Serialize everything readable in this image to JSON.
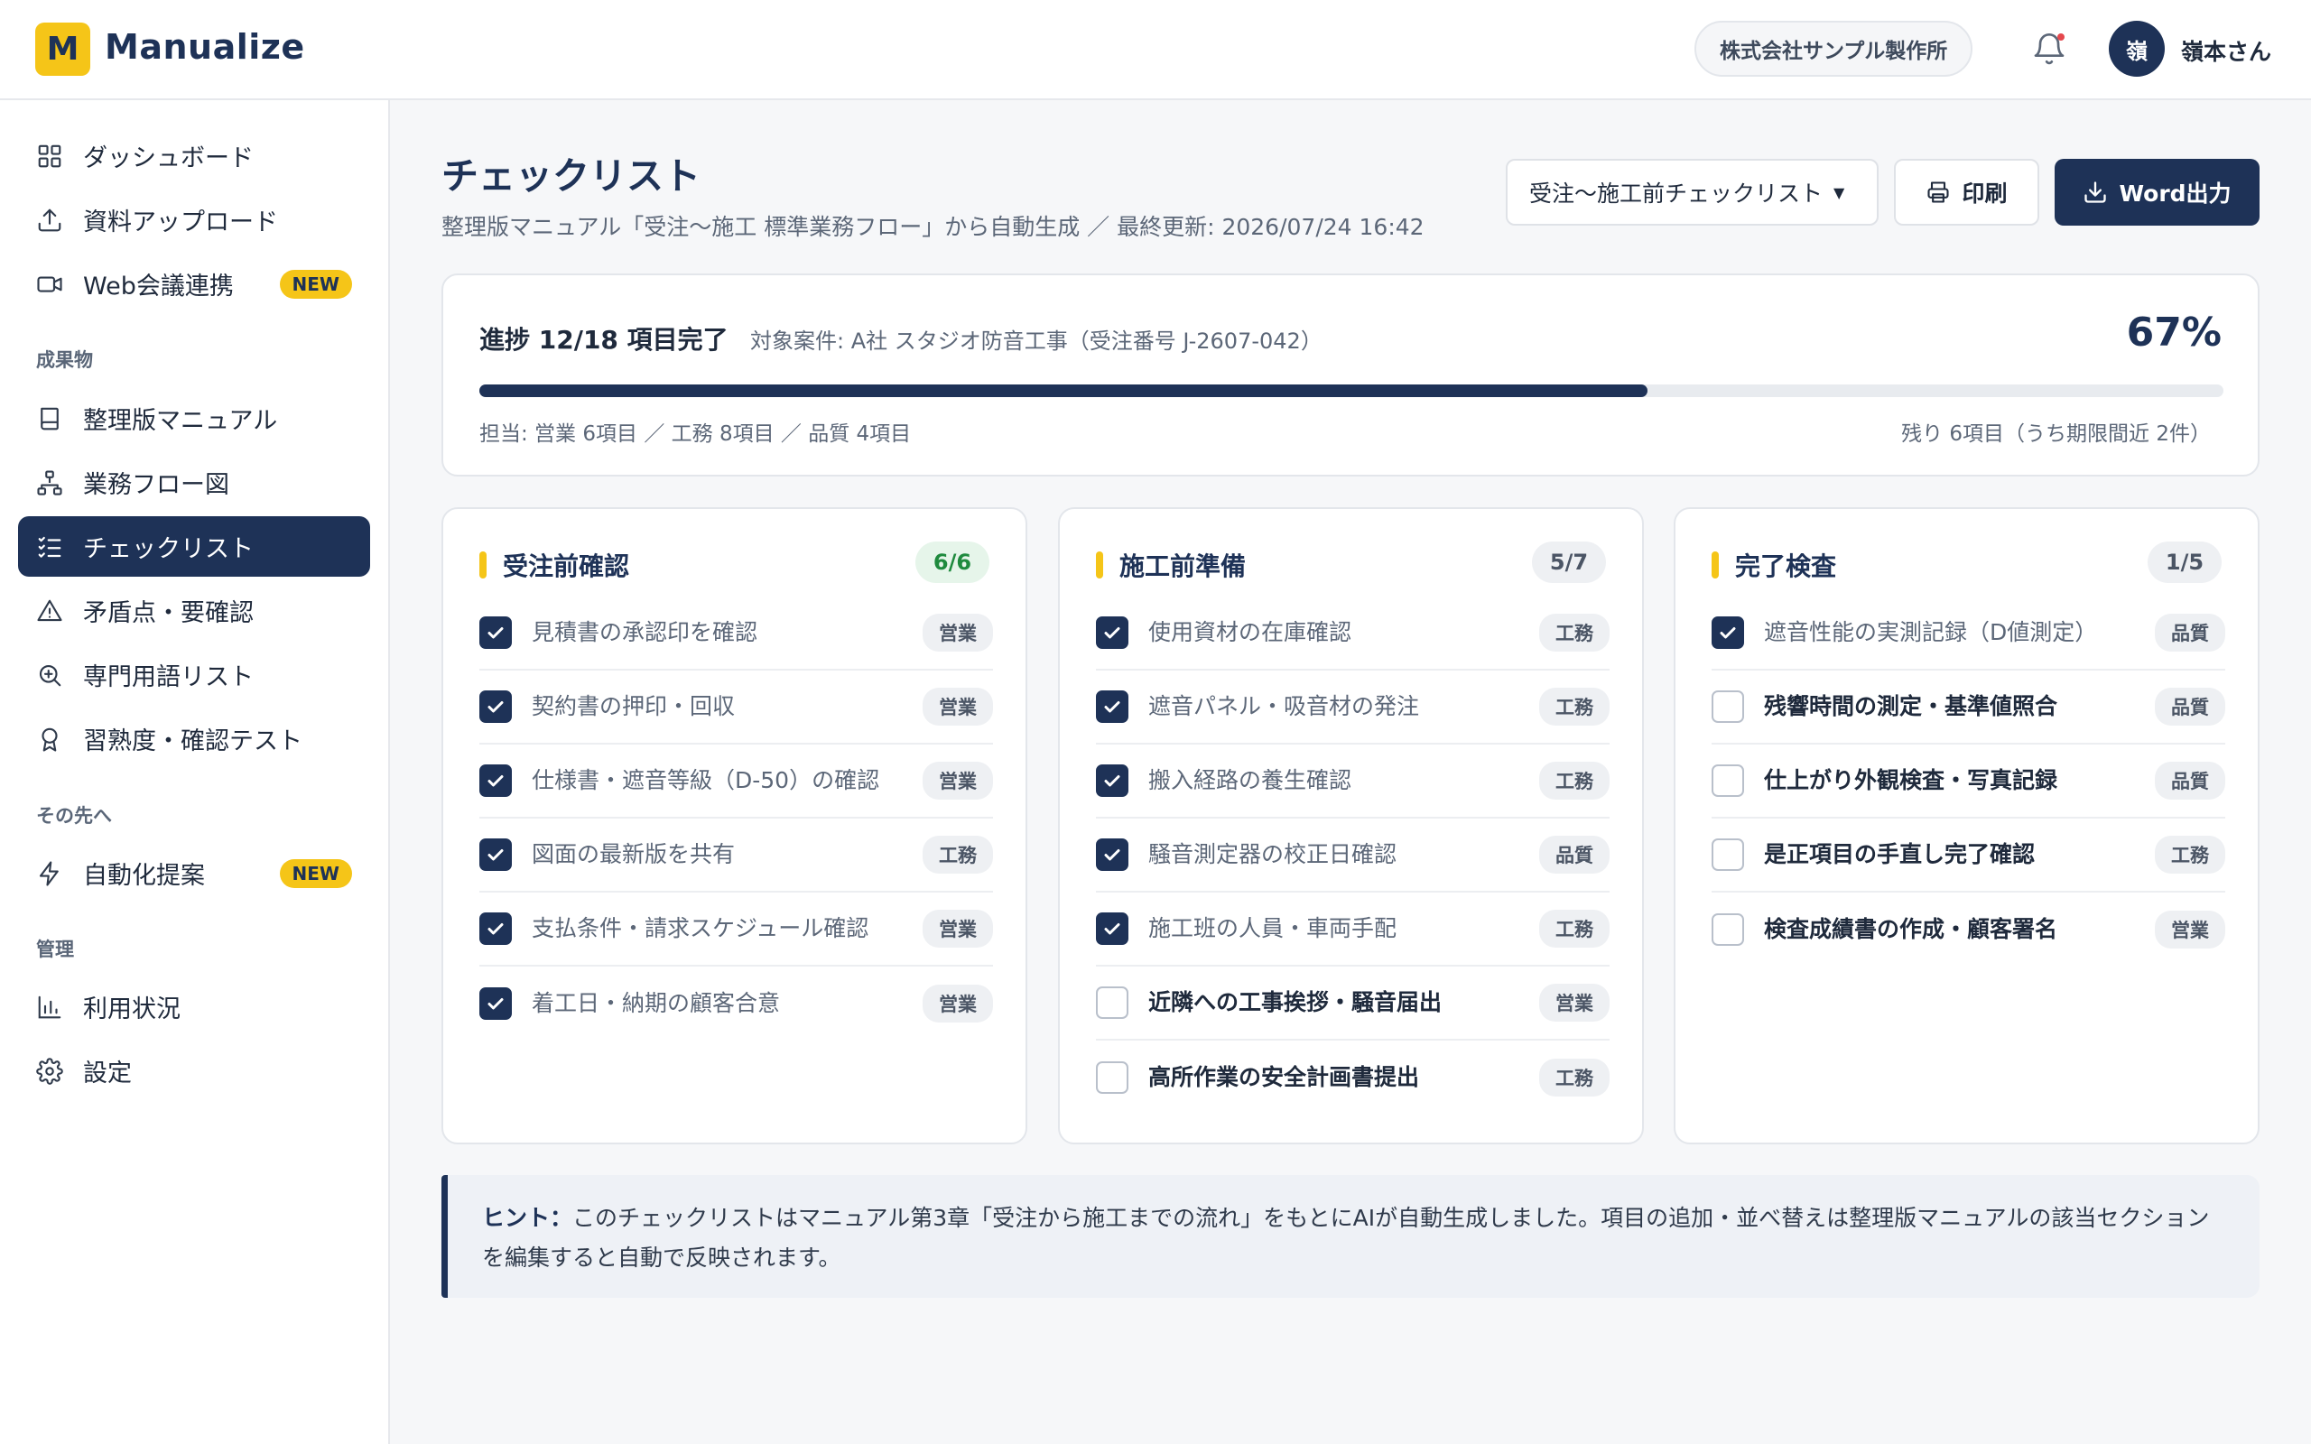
{
  "app": {
    "logo_letter": "M",
    "name": "Manualize"
  },
  "header": {
    "company": "株式会社サンプル製作所",
    "avatar_initial": "嶺",
    "user_name": "嶺本さん"
  },
  "sidebar": {
    "items": [
      {
        "label": "ダッシュボード",
        "icon": "grid-icon"
      },
      {
        "label": "資料アップロード",
        "icon": "upload-icon"
      },
      {
        "label": "Web会議連携",
        "icon": "video-icon",
        "badge": "NEW"
      }
    ],
    "section_outputs": "成果物",
    "output_items": [
      {
        "label": "整理版マニュアル",
        "icon": "book-icon"
      },
      {
        "label": "業務フロー図",
        "icon": "flow-icon"
      },
      {
        "label": "チェックリスト",
        "icon": "checklist-icon",
        "active": true
      },
      {
        "label": "矛盾点・要確認",
        "icon": "warning-icon"
      },
      {
        "label": "専門用語リスト",
        "icon": "magnifier-icon"
      },
      {
        "label": "習熟度・確認テスト",
        "icon": "award-icon"
      }
    ],
    "section_next": "その先へ",
    "next_items": [
      {
        "label": "自動化提案",
        "icon": "lightning-icon",
        "badge": "NEW"
      }
    ],
    "section_admin": "管理",
    "admin_items": [
      {
        "label": "利用状況",
        "icon": "bar-chart-icon"
      },
      {
        "label": "設定",
        "icon": "gear-icon"
      }
    ]
  },
  "main": {
    "title": "チェックリスト",
    "subtitle": "整理版マニュアル「受注〜施工 標準業務フロー」から自動生成 ／ 最終更新: 2026/07/24 16:42",
    "select_value": "受注〜施工前チェックリスト",
    "print_label": "印刷",
    "word_label": "Word出力"
  },
  "progress": {
    "title": "進捗 12/18 項目完了",
    "target": "対象案件: A社 スタジオ防音工事（受注番号 J-2607-042）",
    "percent_label": "67%",
    "fraction": 0.67,
    "assign": "担当: 営業 6項目 ／ 工務 8項目 ／ 品質 4項目",
    "remain": "残り 6項目（うち期限間近 2件）"
  },
  "columns": [
    {
      "title": "受注前確認",
      "count": "6/6",
      "complete": true,
      "items": [
        {
          "label": "見積書の承認印を確認",
          "tag": "営業",
          "checked": true
        },
        {
          "label": "契約書の押印・回収",
          "tag": "営業",
          "checked": true
        },
        {
          "label": "仕様書・遮音等級（D-50）の確認",
          "tag": "営業",
          "checked": true
        },
        {
          "label": "図面の最新版を共有",
          "tag": "工務",
          "checked": true
        },
        {
          "label": "支払条件・請求スケジュール確認",
          "tag": "営業",
          "checked": true
        },
        {
          "label": "着工日・納期の顧客合意",
          "tag": "営業",
          "checked": true
        }
      ]
    },
    {
      "title": "施工前準備",
      "count": "5/7",
      "complete": false,
      "items": [
        {
          "label": "使用資材の在庫確認",
          "tag": "工務",
          "checked": true
        },
        {
          "label": "遮音パネル・吸音材の発注",
          "tag": "工務",
          "checked": true
        },
        {
          "label": "搬入経路の養生確認",
          "tag": "工務",
          "checked": true
        },
        {
          "label": "騒音測定器の校正日確認",
          "tag": "品質",
          "checked": true
        },
        {
          "label": "施工班の人員・車両手配",
          "tag": "工務",
          "checked": true
        },
        {
          "label": "近隣への工事挨拶・騒音届出",
          "tag": "営業",
          "checked": false
        },
        {
          "label": "高所作業の安全計画書提出",
          "tag": "工務",
          "checked": false
        }
      ]
    },
    {
      "title": "完了検査",
      "count": "1/5",
      "complete": false,
      "items": [
        {
          "label": "遮音性能の実測記録（D値測定）",
          "tag": "品質",
          "checked": true
        },
        {
          "label": "残響時間の測定・基準値照合",
          "tag": "品質",
          "checked": false
        },
        {
          "label": "仕上がり外観検査・写真記録",
          "tag": "品質",
          "checked": false
        },
        {
          "label": "是正項目の手直し完了確認",
          "tag": "工務",
          "checked": false
        },
        {
          "label": "検査成績書の作成・顧客署名",
          "tag": "営業",
          "checked": false
        }
      ]
    }
  ],
  "hint": {
    "label": "ヒント：",
    "text": "このチェックリストはマニュアル第3章「受注から施工までの流れ」をもとにAIが自動生成しました。項目の追加・並べ替えは整理版マニュアルの該当セクションを編集すると自動で反映されます。"
  },
  "colors": {
    "navy": "#1e3257",
    "accent_yellow": "#f5c518",
    "complete_green": "#1f8a3e"
  }
}
